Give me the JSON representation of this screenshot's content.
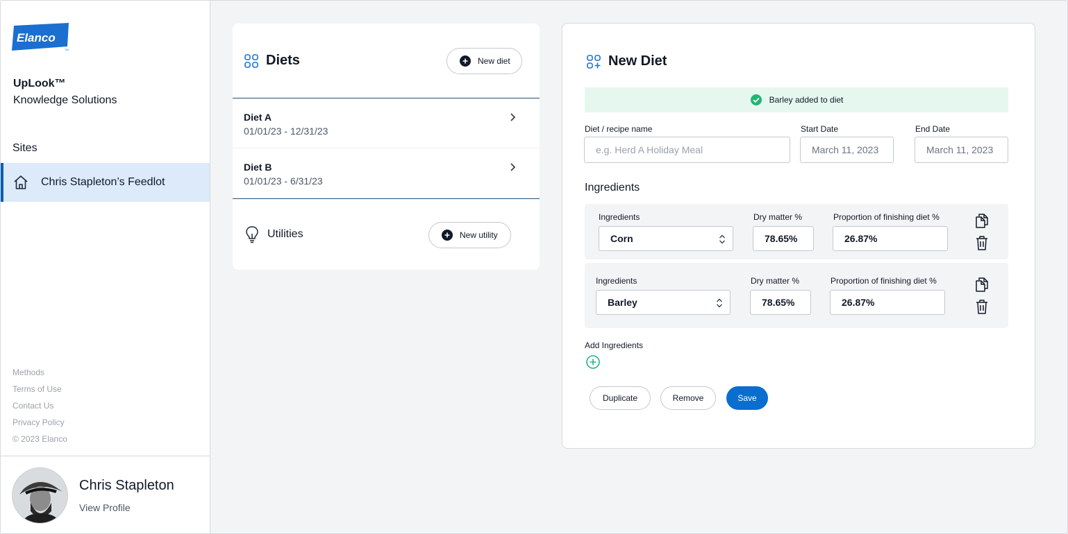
{
  "brand": {
    "logo_text": "Elanco",
    "accent": "#0b5fb5",
    "logo_color": "#1a6fd1"
  },
  "app": {
    "name": "UpLook™",
    "subtitle": "Knowledge Solutions"
  },
  "sidebar": {
    "sites_label": "Sites",
    "sites": [
      {
        "label": "Chris Stapleton’s Feedlot",
        "icon": "home-icon",
        "selected": true
      }
    ],
    "footer_links": [
      "Methods",
      "Terms of Use",
      "Contact Us",
      "Privacy Policy"
    ],
    "copyright": "© 2023 Elanco"
  },
  "profile": {
    "name": "Chris Stapleton",
    "link": "View Profile"
  },
  "diets": {
    "title": "Diets",
    "icon": "grid-icon",
    "new_button": "New diet",
    "items": [
      {
        "name": "Diet A",
        "range": "01/01/23 - 12/31/23"
      },
      {
        "name": "Diet B",
        "range": "01/01/23 - 6/31/23"
      }
    ],
    "utilities": {
      "title": "Utilities",
      "icon": "lightbulb-icon",
      "new_button": "New utility"
    }
  },
  "new_diet": {
    "title": "New Diet",
    "icon": "grid-plus-icon",
    "toast": {
      "text": "Barley added to diet",
      "color": "#e6f7ef",
      "icon": "check-circle-icon"
    },
    "name_field": {
      "label": "Diet / recipe name",
      "placeholder": "e.g. Herd A Holiday Meal",
      "value": ""
    },
    "start_date": {
      "label": "Start Date",
      "value": "March 11, 2023"
    },
    "end_date": {
      "label": "End Date",
      "value": "March 11, 2023"
    },
    "ingredients_title": "Ingredients",
    "ingredients": [
      {
        "label": "Ingredients",
        "value": "Corn",
        "dm_label": "Dry matter %",
        "dm_value": "78.65%",
        "prop_label": "Proportion of finishing diet %",
        "prop_value": "26.87%"
      },
      {
        "label": "Ingredients",
        "value": "Barley",
        "dm_label": "Dry matter %",
        "dm_value": "78.65%",
        "prop_label": "Proportion of finishing diet %",
        "prop_value": "26.87%"
      }
    ],
    "add_label": "Add Ingredients",
    "actions": {
      "duplicate": "Duplicate",
      "remove": "Remove",
      "save": "Save"
    },
    "primary_color": "#0a6ecf"
  }
}
